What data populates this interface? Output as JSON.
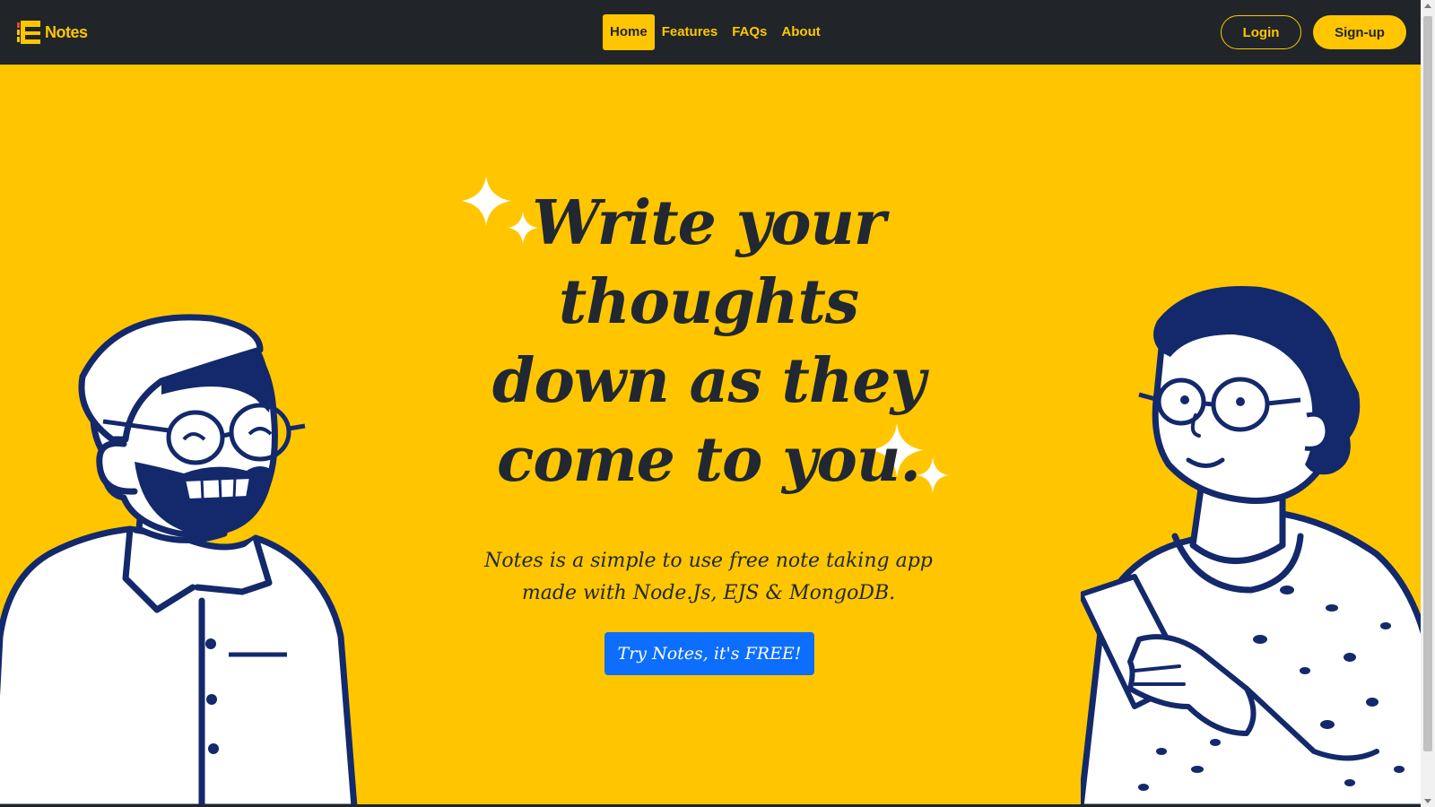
{
  "brand": {
    "name": "Notes"
  },
  "nav": {
    "links": [
      {
        "label": "Home",
        "active": true
      },
      {
        "label": "Features",
        "active": false
      },
      {
        "label": "FAQs",
        "active": false
      },
      {
        "label": "About",
        "active": false
      }
    ],
    "login_label": "Login",
    "signup_label": "Sign-up"
  },
  "hero": {
    "title": "Write your thoughts down as they come to you.",
    "description": "Notes is a simple to use free note taking app made with Node.Js, EJS & MongoDB.",
    "cta_label": "Try Notes, it's FREE!"
  },
  "colors": {
    "background": "#ffc600",
    "navbar": "#212529",
    "accent": "#ffc600",
    "cta": "#0d6efd",
    "illustration": "#13296b"
  }
}
